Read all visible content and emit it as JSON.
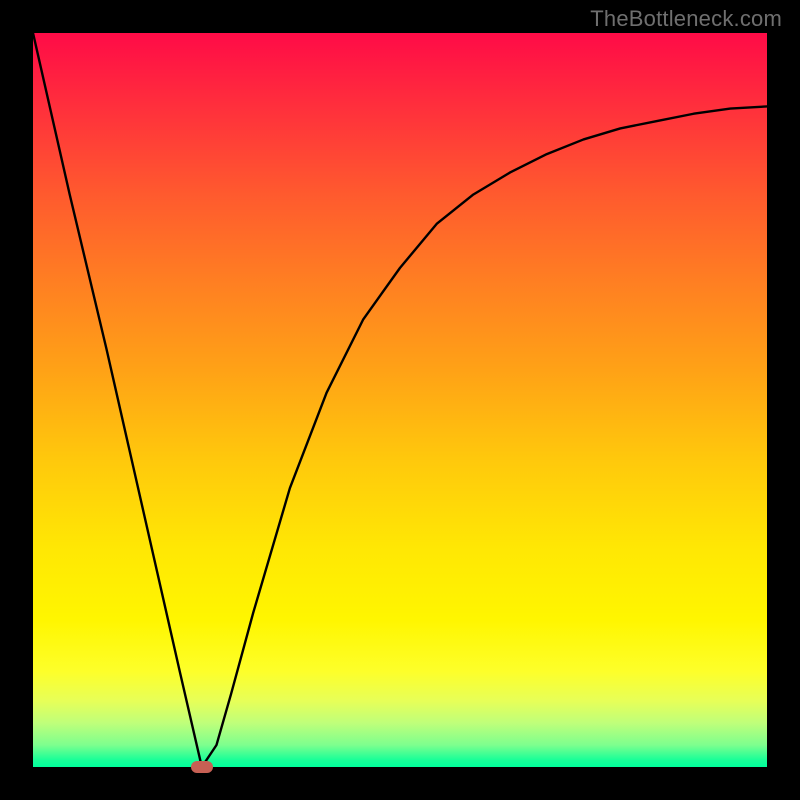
{
  "watermark": "TheBottleneck.com",
  "chart_data": {
    "type": "line",
    "title": "",
    "xlabel": "",
    "ylabel": "",
    "xlim": [
      0,
      100
    ],
    "ylim": [
      0,
      100
    ],
    "grid": false,
    "legend": false,
    "series": [
      {
        "name": "curve",
        "x": [
          0,
          5,
          10,
          15,
          20,
          23,
          25,
          27,
          30,
          35,
          40,
          45,
          50,
          55,
          60,
          65,
          70,
          75,
          80,
          85,
          90,
          95,
          100
        ],
        "y": [
          100,
          78,
          57,
          35,
          13,
          0,
          3,
          10,
          21,
          38,
          51,
          61,
          68,
          74,
          78,
          81,
          83.5,
          85.5,
          87,
          88,
          89,
          89.7,
          90
        ]
      }
    ],
    "marker": {
      "x": 23,
      "y": 0,
      "color": "#c76054"
    },
    "background_gradient": {
      "stops": [
        {
          "pos": 0,
          "color": "#ff0b47"
        },
        {
          "pos": 34,
          "color": "#ff7f22"
        },
        {
          "pos": 70,
          "color": "#ffe704"
        },
        {
          "pos": 100,
          "color": "#00ff9c"
        }
      ]
    }
  }
}
